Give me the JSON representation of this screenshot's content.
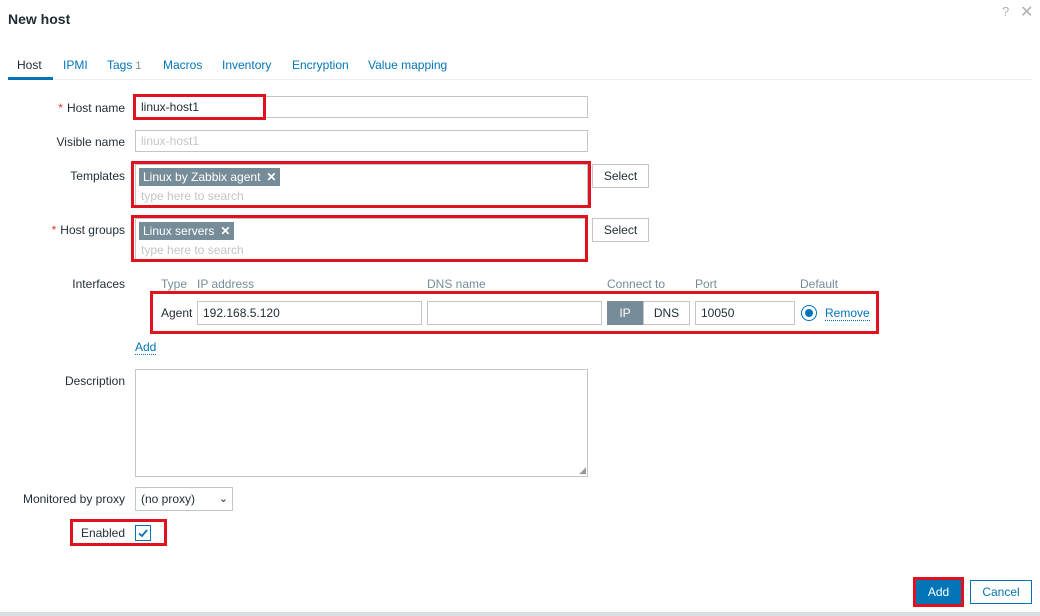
{
  "dialog": {
    "title": "New host",
    "help_icon": "question-mark-icon",
    "close_icon": "close-icon"
  },
  "tabs": [
    {
      "label": "Host"
    },
    {
      "label": "IPMI"
    },
    {
      "label": "Tags",
      "count": "1"
    },
    {
      "label": "Macros"
    },
    {
      "label": "Inventory"
    },
    {
      "label": "Encryption"
    },
    {
      "label": "Value mapping"
    }
  ],
  "form": {
    "host_name": {
      "label": "Host name",
      "required": "*",
      "value": "linux-host1"
    },
    "visible_name": {
      "label": "Visible name",
      "placeholder": "linux-host1"
    },
    "templates": {
      "label": "Templates",
      "chips": [
        "Linux by Zabbix agent"
      ],
      "placeholder": "type here to search",
      "select_label": "Select"
    },
    "host_groups": {
      "label": "Host groups",
      "required": "*",
      "chips": [
        "Linux servers"
      ],
      "placeholder": "type here to search",
      "select_label": "Select"
    },
    "interfaces": {
      "label": "Interfaces",
      "columns": [
        "Type",
        "IP address",
        "DNS name",
        "Connect to",
        "Port",
        "Default"
      ],
      "rows": [
        {
          "type": "Agent",
          "ip": "192.168.5.120",
          "dns": "",
          "connect_options": [
            "IP",
            "DNS"
          ],
          "connect_selected": "IP",
          "port": "10050",
          "default": true,
          "remove_label": "Remove"
        }
      ],
      "add_label": "Add"
    },
    "description": {
      "label": "Description",
      "value": ""
    },
    "proxy": {
      "label": "Monitored by proxy",
      "selected": "(no proxy)"
    },
    "enabled": {
      "label": "Enabled",
      "checked": true
    }
  },
  "footer": {
    "add_label": "Add",
    "cancel_label": "Cancel"
  },
  "colors": {
    "accent": "#0275b8",
    "highlight": "#e0121e",
    "chip": "#768d99",
    "required": "#e33734"
  }
}
